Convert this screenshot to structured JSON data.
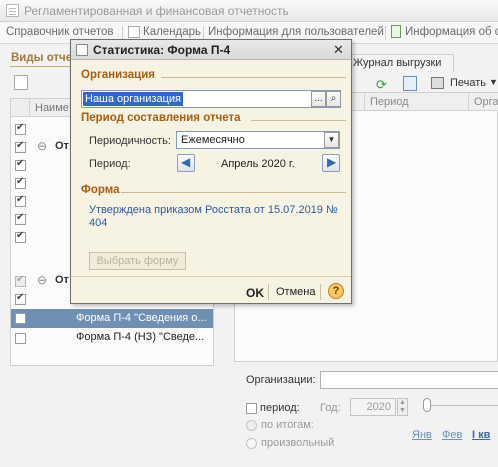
{
  "window": {
    "title": "Регламентированная и финансовая отчетность"
  },
  "toolbar": {
    "items": [
      "Справочник отчетов",
      "Календарь",
      "Информация для пользователей",
      "Информация об об"
    ]
  },
  "left_panel": {
    "title": "Виды отче",
    "column_header": "Наиме",
    "rows": [
      {
        "text": "",
        "checked": true
      },
      {
        "text": "От",
        "checked": true,
        "group": true,
        "expand": "⊖"
      },
      {
        "text": "",
        "checked": true
      },
      {
        "text": "",
        "checked": true
      },
      {
        "text": "",
        "checked": true
      },
      {
        "text": "",
        "checked": true
      },
      {
        "text": "",
        "checked": true
      },
      {
        "text": "От",
        "checked": true,
        "group": true,
        "dim": true,
        "expand": "⊖"
      },
      {
        "text": "",
        "checked": true
      },
      {
        "text": "Форма П-4 \"Сведения о...",
        "checked": false,
        "selected": true
      },
      {
        "text": "Форма П-4 (НЗ) \"Сведе...",
        "checked": false
      }
    ]
  },
  "right_panel": {
    "tab": "Журнал выгрузки",
    "print_label": "Печать",
    "columns": [
      "",
      "Период",
      "Орган"
    ],
    "organizations_label": "Организации:",
    "period_checkbox_label": "период:",
    "year_label": "Год:",
    "year_value": "2020",
    "radio_totals": "по итогам:",
    "radio_custom": "произвольный",
    "months": [
      "Янв",
      "Фев",
      "I кв"
    ]
  },
  "dialog": {
    "title": "Статистика: Форма П-4",
    "org_section": "Организация",
    "org_value": "Наша организация",
    "period_section": "Период составления отчета",
    "periodicity_label": "Периодичность:",
    "periodicity_value": "Ежемесячно",
    "period_label": "Период:",
    "period_value": "Апрель 2020 г.",
    "form_section": "Форма",
    "form_link": "Утверждена приказом Росстата от 15.07.2019 № 404",
    "select_form_button": "Выбрать форму",
    "ok_button": "OK",
    "cancel_button": "Отмена",
    "help_button": "?",
    "close_button": "✕",
    "ellipsis_button": "...",
    "search_icon": "magnifier"
  }
}
